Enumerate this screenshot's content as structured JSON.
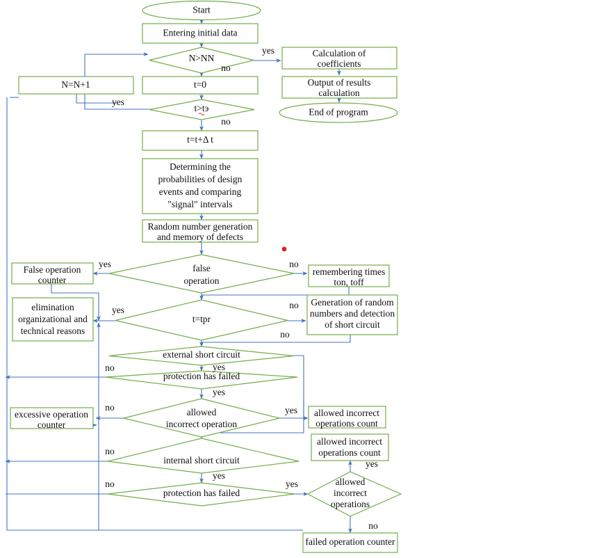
{
  "diagram": {
    "title": "Simulation algorithm flowchart",
    "colors": {
      "node_border": "#70AD47",
      "connector": "#4472C4",
      "text": "#0d0d0d",
      "marker": "#E02020",
      "background": "#ffffff"
    }
  },
  "nodes": {
    "start": {
      "label": "Start",
      "shape": "terminator"
    },
    "entering_initial_data": {
      "label": "Entering initial data",
      "shape": "process"
    },
    "n_gt_nn": {
      "label": "N>NN",
      "shape": "decision"
    },
    "calculation_of_coefficients": {
      "label_line1": "Calculation of",
      "label_line2": "coefficients",
      "shape": "process"
    },
    "output_of_results": {
      "label_line1": "Output of results",
      "label_line2": "calculation",
      "shape": "process"
    },
    "end_of_program": {
      "label": "End of program",
      "shape": "terminator"
    },
    "n_increment": {
      "label": "N=N+1",
      "shape": "process"
    },
    "t_zero": {
      "label": "t=0",
      "shape": "process"
    },
    "t_gt_te": {
      "label": "t>tэ",
      "shape": "decision"
    },
    "t_increment": {
      "label": "t=t+Δ t",
      "shape": "process"
    },
    "determining_probabilities": {
      "label_line1": "Determining the",
      "label_line2": "probabilities of design",
      "label_line3": "events and comparing",
      "label_line4": "\"signal\" intervals",
      "shape": "process"
    },
    "random_number_generation": {
      "label_line1": "Random number generation",
      "label_line2": "and memory of defects",
      "shape": "process"
    },
    "false_operation_decision": {
      "label_line1": "false",
      "label_line2": "operation",
      "shape": "decision"
    },
    "false_operation_counter": {
      "label_line1": "False operation",
      "label_line2": "counter",
      "shape": "process"
    },
    "remembering_times": {
      "label_line1": "remembering times",
      "label_line2": "ton, toff",
      "shape": "process"
    },
    "t_eq_tpr": {
      "label": "t=tpr",
      "shape": "decision"
    },
    "elimination_reasons": {
      "label_line1": "elimination",
      "label_line2": "organizational and",
      "label_line3": "technical reasons",
      "shape": "process"
    },
    "generation_random_numbers": {
      "label_line1": "Generation of random",
      "label_line2": "numbers and detection",
      "label_line3": "of short circuit",
      "shape": "process"
    },
    "external_short_circuit": {
      "label": "external short circuit",
      "shape": "decision"
    },
    "protection_failed_1": {
      "label": "protection has failed",
      "shape": "decision"
    },
    "excessive_operation_counter": {
      "label_line1": "excessive operation",
      "label_line2": "counter",
      "shape": "process"
    },
    "allowed_incorrect_operation": {
      "label_line1": "allowed",
      "label_line2": "incorrect operation",
      "shape": "decision"
    },
    "allowed_incorrect_count_1": {
      "label_line1": "allowed incorrect",
      "label_line2": "operations count",
      "shape": "process"
    },
    "allowed_incorrect_count_2": {
      "label_line1": "allowed incorrect",
      "label_line2": "operations count",
      "shape": "process"
    },
    "internal_short_circuit": {
      "label": "internal short circuit",
      "shape": "decision"
    },
    "protection_failed_2": {
      "label": "protection has failed",
      "shape": "decision"
    },
    "allowed_incorrect_operations": {
      "label_line1": "allowed",
      "label_line2": "incorrect",
      "label_line3": "operations",
      "shape": "decision"
    },
    "failed_operation_counter": {
      "label": "failed operation counter",
      "shape": "process"
    }
  },
  "edge_labels": {
    "n_gt_nn_yes": "yes",
    "n_gt_nn_no": "no",
    "t_gt_te_yes": "yes",
    "t_gt_te_no": "no",
    "false_operation_yes": "yes",
    "false_operation_no": "no",
    "t_eq_tpr_yes": "yes",
    "t_eq_tpr_no": "no",
    "external_sc_no": "no",
    "external_sc_yes": "yes",
    "protection_failed_1_no": "no",
    "protection_failed_1_yes": "yes",
    "allowed_incorrect_op_no": "no",
    "allowed_incorrect_op_yes": "yes",
    "internal_sc_no": "no",
    "internal_sc_yes": "yes",
    "protection_failed_2_no": "no",
    "protection_failed_2_yes": "yes",
    "allowed_incorrect_ops_yes": "yes",
    "allowed_incorrect_ops_no": "no"
  }
}
